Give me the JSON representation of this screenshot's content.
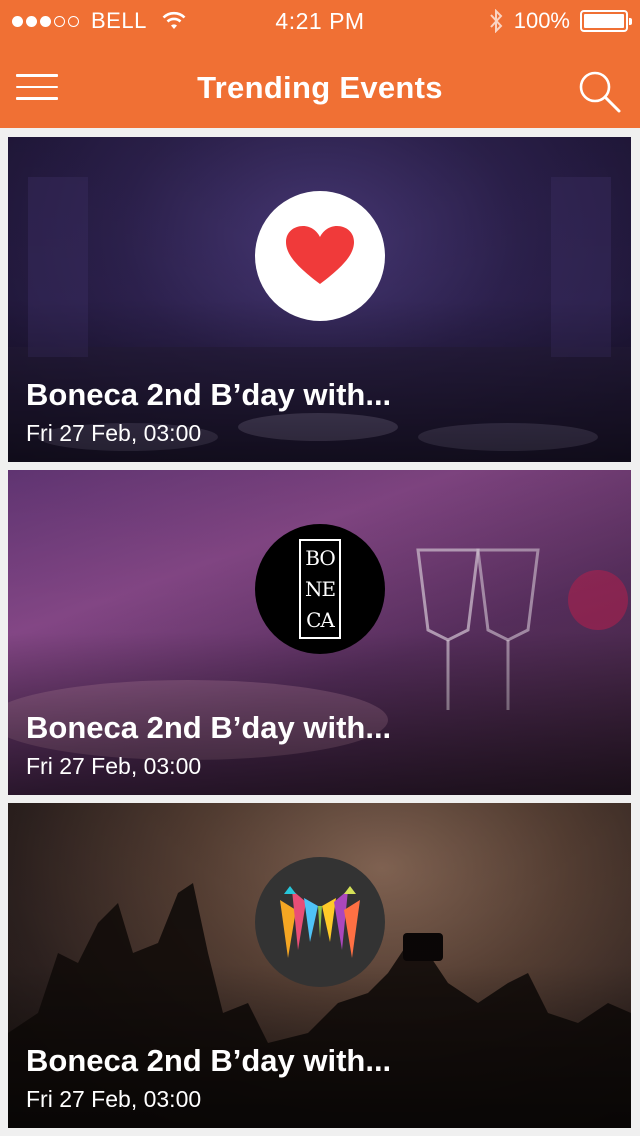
{
  "status_bar": {
    "signal_dots_filled": 3,
    "signal_dots_total": 5,
    "carrier": "BELL",
    "time": "4:21 PM",
    "battery": "100%",
    "battery_level": 1.0
  },
  "nav": {
    "title": "Trending Events",
    "menu_icon": "hamburger-menu-icon",
    "search_icon": "search-icon"
  },
  "events": [
    {
      "title": "Boneca 2nd B’day with...",
      "date": "Fri 27 Feb, 03:00",
      "logo": "heart-icon"
    },
    {
      "title": "Boneca 2nd B’day with...",
      "date": "Fri 27 Feb, 03:00",
      "logo": "boneca-logo",
      "logo_text": [
        "BO",
        "NE",
        "CA"
      ]
    },
    {
      "title": "Boneca 2nd B’day with...",
      "date": "Fri 27 Feb, 03:00",
      "logo": "colorful-m-logo"
    }
  ],
  "colors": {
    "accent": "#f07034",
    "heart": "#f03a3a"
  }
}
